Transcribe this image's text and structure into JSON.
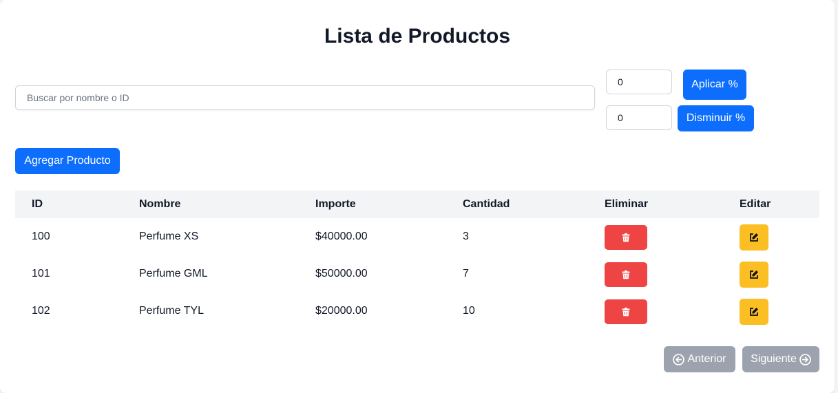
{
  "page": {
    "title": "Lista de Productos"
  },
  "toolbar": {
    "search_placeholder": "Buscar por nombre o ID",
    "increase_value": "0",
    "increase_label": "Aplicar %",
    "decrease_value": "0",
    "decrease_label": "Disminuir %",
    "add_label": "Agregar Producto"
  },
  "table": {
    "headers": [
      "ID",
      "Nombre",
      "Importe",
      "Cantidad",
      "Eliminar",
      "Editar"
    ],
    "rows": [
      {
        "id": "100",
        "nombre": "Perfume XS",
        "importe": "$40000.00",
        "cantidad": "3"
      },
      {
        "id": "101",
        "nombre": "Perfume GML",
        "importe": "$50000.00",
        "cantidad": "7"
      },
      {
        "id": "102",
        "nombre": "Perfume TYL",
        "importe": "$20000.00",
        "cantidad": "10"
      }
    ]
  },
  "pagination": {
    "prev_label": "Anterior",
    "next_label": "Siguiente"
  },
  "icons": {
    "delete": "trash-icon",
    "edit": "edit-icon",
    "prev": "arrow-left-circle-icon",
    "next": "arrow-right-circle-icon"
  },
  "colors": {
    "primary": "#0d6efd",
    "danger": "#ef4444",
    "warning": "#fbbf24",
    "disabled": "#9ca3af"
  }
}
